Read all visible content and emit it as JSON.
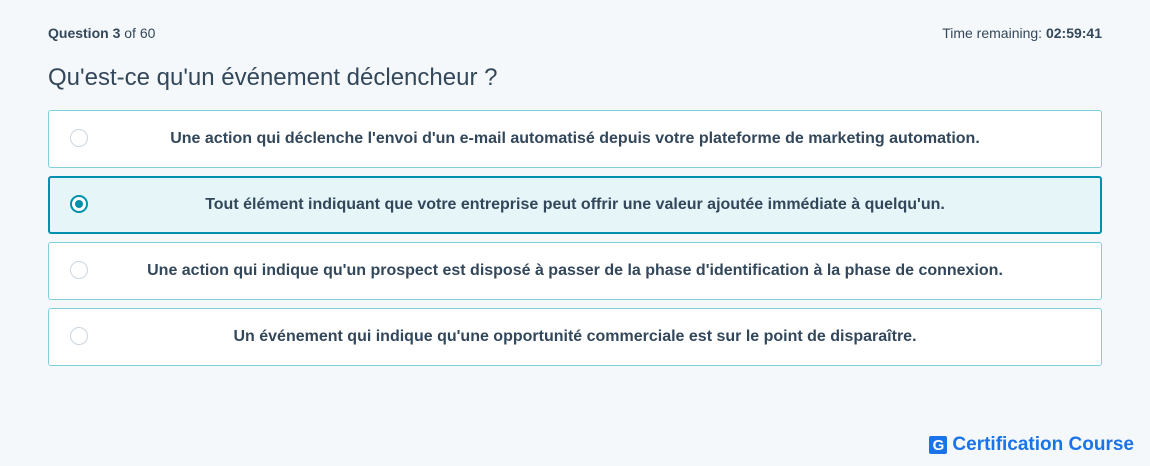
{
  "header": {
    "question_label": "Question",
    "question_number": "3",
    "question_of": "of 60",
    "timer_label": "Time remaining:",
    "timer_value": "02:59:41"
  },
  "question": {
    "title": "Qu'est-ce qu'un événement déclencheur ?"
  },
  "options": [
    {
      "label": "Une action qui déclenche l'envoi d'un e-mail automatisé depuis votre plateforme de marketing automation.",
      "selected": false
    },
    {
      "label": "Tout élément indiquant que votre entreprise peut offrir une valeur ajoutée immédiate à quelqu'un.",
      "selected": true
    },
    {
      "label": "Une action qui indique qu'un prospect est disposé à passer de la phase d'identification à la phase de connexion.",
      "selected": false
    },
    {
      "label": "Un événement qui indique qu'une opportunité commerciale est sur le point de disparaître.",
      "selected": false
    }
  ],
  "brand": {
    "logo_letter": "G",
    "name": "Certification Course",
    "color": "#1a73e8"
  },
  "colors": {
    "accent": "#0091ae",
    "option_border": "#7fd1de",
    "selected_bg": "#e5f5f8",
    "text": "#33475b",
    "page_bg": "#f5f8fa"
  }
}
